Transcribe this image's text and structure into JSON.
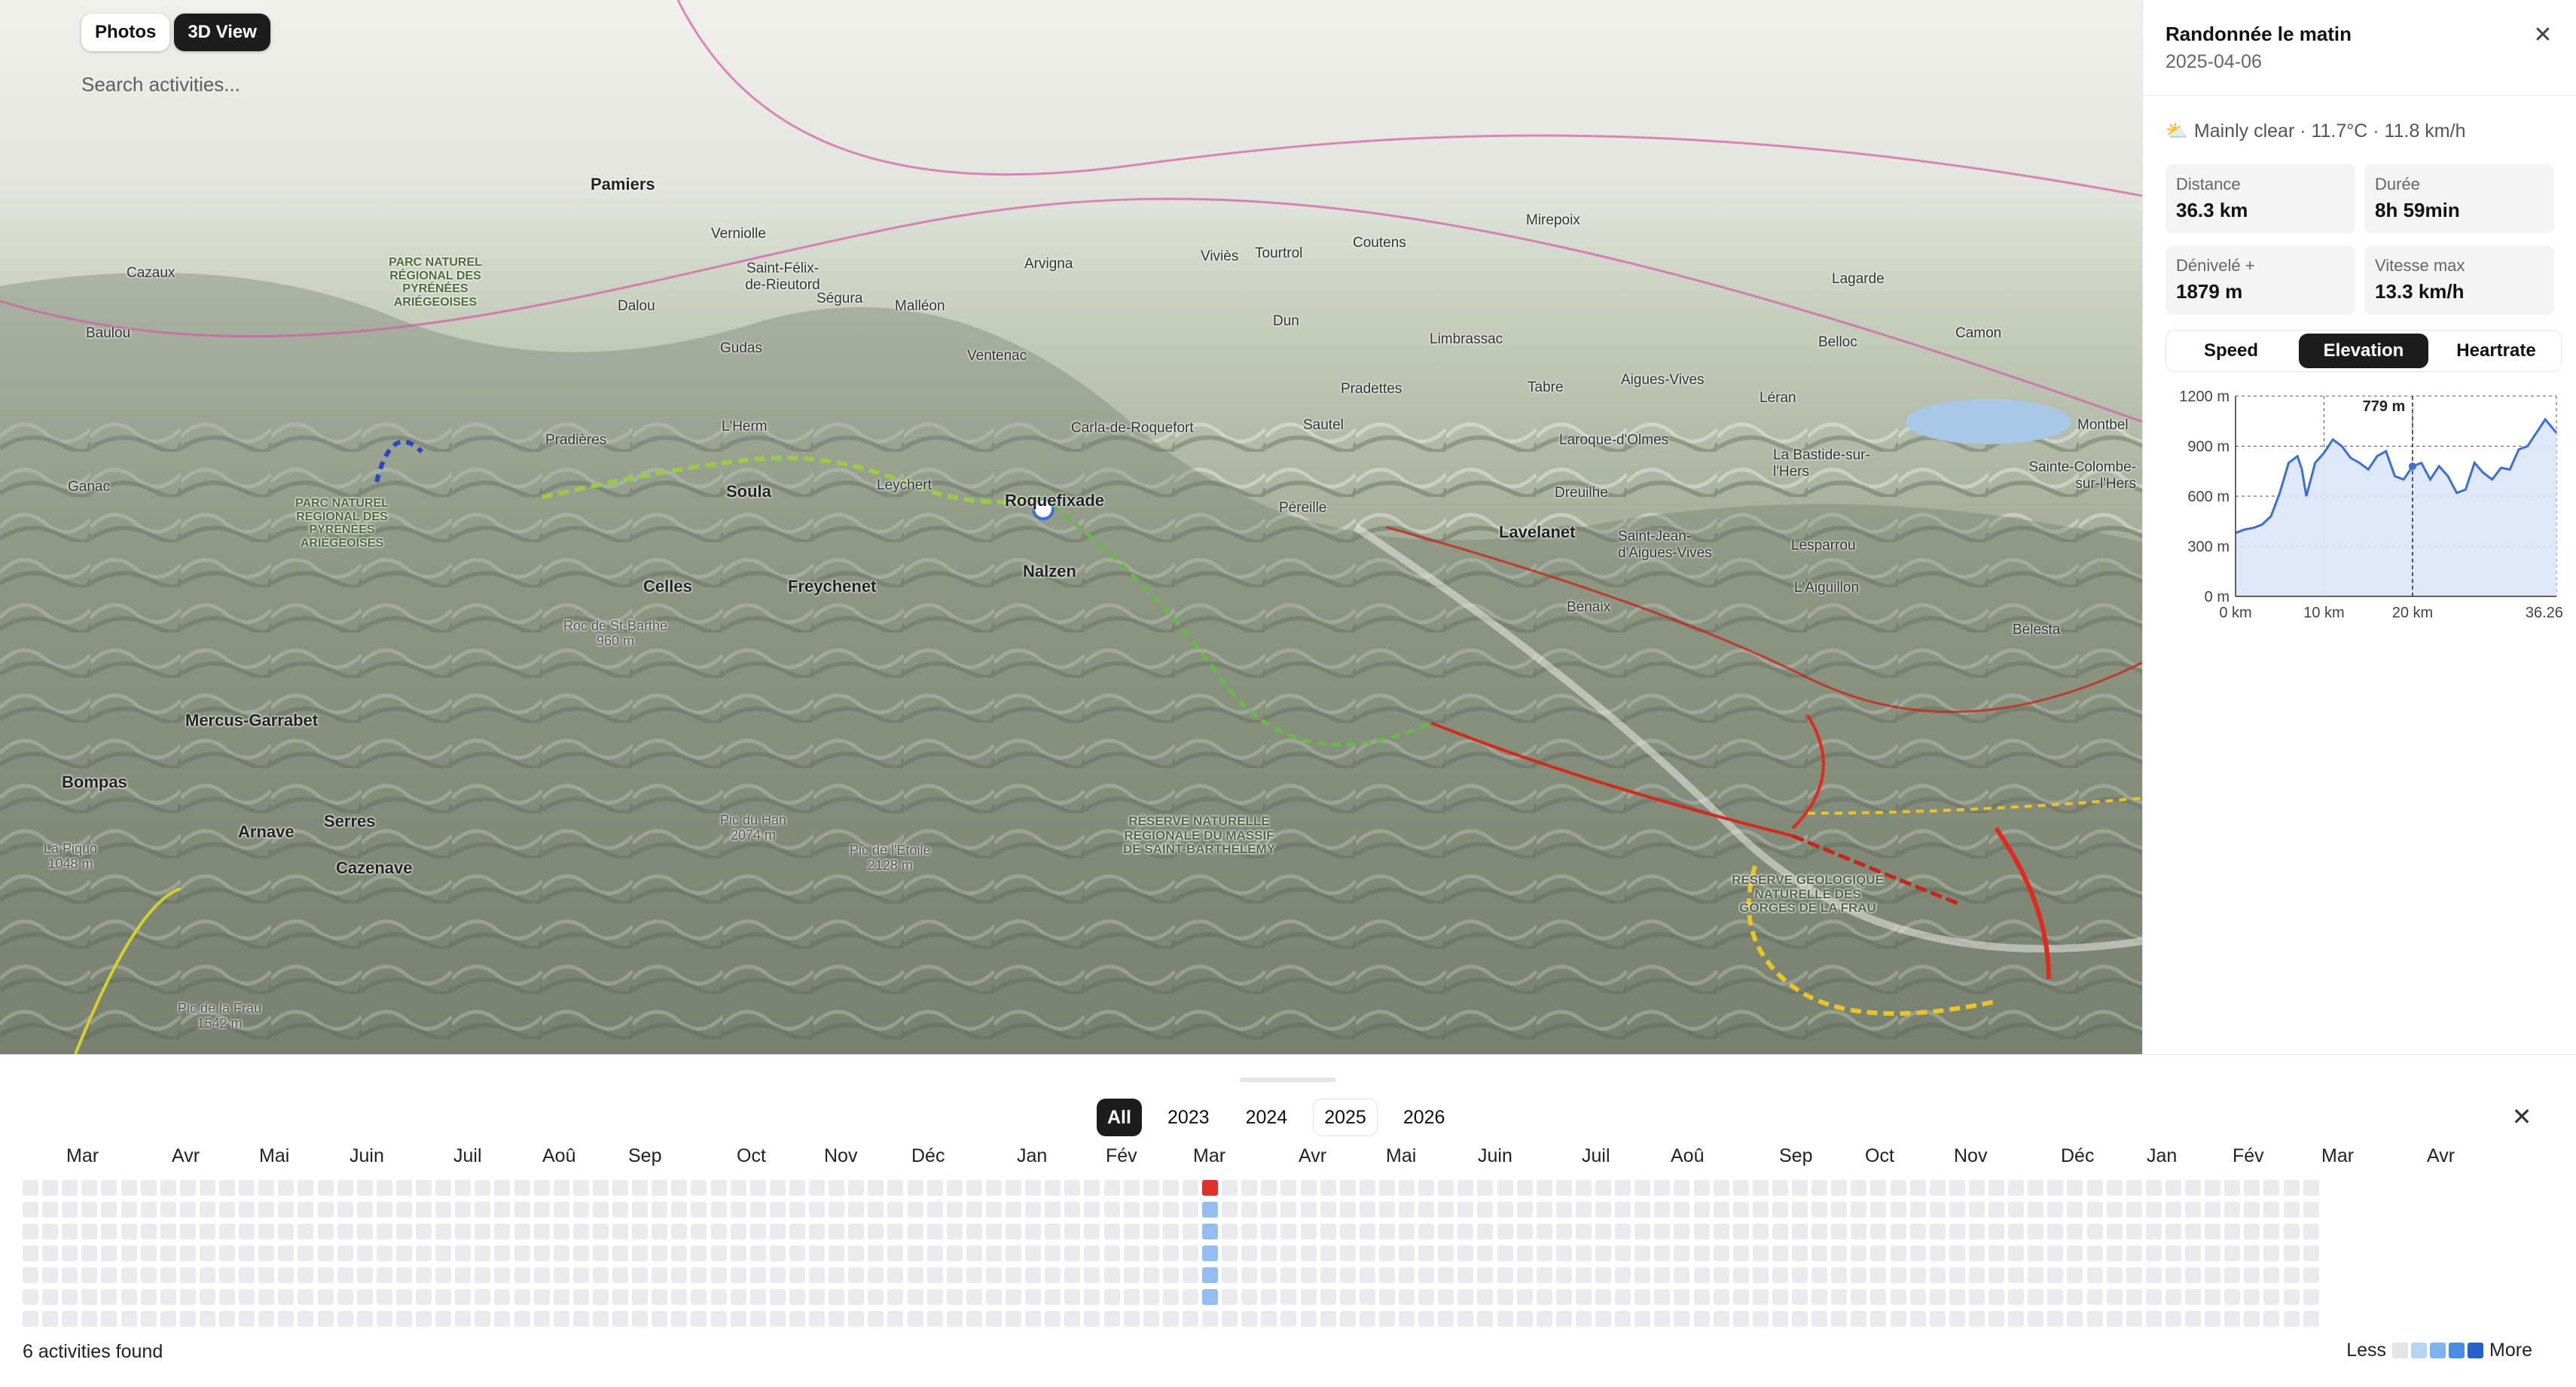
{
  "map": {
    "view_toggle": {
      "photos": "Photos",
      "view3d": "3D View",
      "active": "3D View"
    },
    "search": {
      "placeholder": "Search activities..."
    },
    "labels": {
      "pamiers": "Pamiers",
      "lavelanet": "Lavelanet",
      "foix_region": "PARC NATUREL RÉGIONAL DES PYRÉNÉES ARIÉGEOISES",
      "park2": "PARC NATUREL RÉGIONAL DES PYRÉNÉES ARIÉGEOISES",
      "reserve": "RÉSERVE NATURELLE RÉGIONALE DU MASSIF DE SAINT-BARTHÉLEMY",
      "reserve2": "RÉSERVE GÉOLOGIQUE NATURELLE DES GORGES DE LA FRAU",
      "mercus": "Mercus-Garrabet",
      "bompas": "Bompas",
      "arnave": "Arnave",
      "serres": "Serres",
      "cazenave": "Cazenave",
      "celles": "Celles",
      "freychenet": "Freychenet",
      "nalzen": "Nalzen",
      "roquefixade": "Roquefixade",
      "soula": "Soula",
      "pradieres": "Pradières",
      "lherm": "L'Herm",
      "dalou": "Dalou",
      "gudas": "Gudas",
      "segura": "Ségura",
      "malleon": "Malléon",
      "ventenac": "Ventenac",
      "leychert": "Leychert",
      "pereille": "Péreille",
      "carla": "Carla-de-Roquefort",
      "sautel": "Sautel",
      "dreuilhe": "Dreuilhe",
      "benaix": "Bénaix",
      "laroque": "Laroque-d'Olmes",
      "tabre": "Tabre",
      "stjean": "Saint-Jean-d'Aigues-Vives",
      "aigues": "Aigues-Vives",
      "leran": "Léran",
      "lesparrou": "Lesparrou",
      "laguillon": "L'Aiguillon",
      "belesta": "Bélesta",
      "labastide": "La Bastide-sur-l'Hers",
      "saintecolombe": "Sainte-Colombe-sur-l'Hers",
      "montbel": "Montbel",
      "belloc": "Belloc",
      "camon": "Camon",
      "lagarde": "Lagarde",
      "mirepoix": "Mirepoix",
      "coutens": "Coutens",
      "tourtrol": "Tourtrol",
      "vivies": "Viviès",
      "limbrassac": "Limbrassac",
      "pradettes": "Pradettes",
      "dun": "Dun",
      "arvigna": "Arvigna",
      "verniolle": "Verniolle",
      "stfelix": "Saint-Félix-de-Rieutord",
      "ganac": "Ganac",
      "baulou": "Baulou",
      "cazaux": "Cazaux",
      "piedhan": "Pic du Han\n2074 m",
      "pieteriou": "Pic de l'Étoile\n2128 m",
      "picfrau": "Pic de la Frau\n1542 m",
      "piquo": "La Piquo\n1048 m",
      "rocsara": "Roc de St-Barthe\n960 m"
    }
  },
  "panel": {
    "title": "Randonnée le matin",
    "date": "2025-04-06",
    "weather": "Mainly clear · 11.7°C · 11.8 km/h",
    "weather_icon": "sun-cloud-icon",
    "stats": [
      {
        "label": "Distance",
        "value": "36.3 km"
      },
      {
        "label": "Durée",
        "value": "8h 59min"
      },
      {
        "label": "Dénivelé +",
        "value": "1879 m"
      },
      {
        "label": "Vitesse max",
        "value": "13.3 km/h"
      }
    ],
    "chart_tabs": [
      "Speed",
      "Elevation",
      "Heartrate"
    ],
    "active_tab": "Elevation"
  },
  "chart_data": {
    "type": "area",
    "title": "",
    "xlabel": "",
    "ylabel": "",
    "x_ticks": [
      "0 km",
      "10 km",
      "20 km",
      "36.26 km"
    ],
    "y_ticks": [
      "0 m",
      "300 m",
      "600 m",
      "900 m",
      "1200 m"
    ],
    "ylim": [
      0,
      1200
    ],
    "xlim": [
      0,
      36.26
    ],
    "grid": true,
    "cursor": {
      "x": 20,
      "label": "779 m"
    },
    "series": [
      {
        "x": [
          0,
          1,
          2,
          3,
          4,
          5,
          6,
          7,
          7.5,
          8,
          9,
          10,
          11,
          12,
          13,
          14,
          15,
          16,
          17,
          18,
          19,
          20,
          21,
          22,
          23,
          24,
          25,
          26,
          27,
          28,
          29,
          30,
          31,
          32,
          33,
          34,
          35,
          36.26
        ],
        "y": [
          380,
          400,
          410,
          430,
          480,
          620,
          800,
          840,
          760,
          600,
          800,
          860,
          940,
          900,
          830,
          800,
          760,
          840,
          870,
          720,
          700,
          779,
          800,
          700,
          780,
          720,
          620,
          640,
          800,
          740,
          700,
          770,
          760,
          880,
          900,
          980,
          1060,
          980
        ]
      }
    ],
    "accent": "#3b6fd4"
  },
  "calendar": {
    "years": [
      "All",
      "2023",
      "2024",
      "2025",
      "2026"
    ],
    "active_year": "All",
    "outlined_year": "2025",
    "months": [
      "Mar",
      "Avr",
      "Mai",
      "Juin",
      "Juil",
      "Aoû",
      "Sep",
      "Oct",
      "Nov",
      "Déc",
      "Jan",
      "Fév",
      "Mar",
      "Avr",
      "Mai",
      "Juin",
      "Juil",
      "Aoû",
      "Sep",
      "Oct",
      "Nov",
      "Déc",
      "Jan",
      "Fév",
      "Mar",
      "Avr"
    ],
    "found_text": "6 activities found",
    "legend_less": "Less",
    "legend_more": "More",
    "legend_colors": [
      "#e4e4e8",
      "#b8d4f4",
      "#7fb3ee",
      "#4a8ee4",
      "#2560cc"
    ],
    "highlight_week": 60,
    "highlight_cells": [
      {
        "day": 0,
        "color": "#e0302a"
      },
      {
        "day": 1,
        "color": "#94bdf0"
      },
      {
        "day": 2,
        "color": "#94bdf0"
      },
      {
        "day": 3,
        "color": "#94bdf0"
      },
      {
        "day": 4,
        "color": "#94bdf0"
      },
      {
        "day": 5,
        "color": "#94bdf0"
      }
    ],
    "weeks": 117,
    "days": 7
  }
}
